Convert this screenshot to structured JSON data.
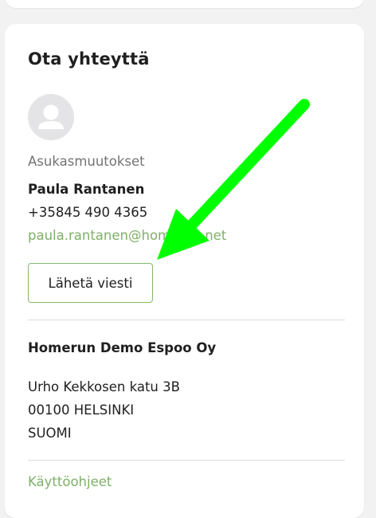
{
  "contact": {
    "title": "Ota yhteyttä",
    "role": "Asukasmuutokset",
    "name": "Paula Rantanen",
    "phone": "+35845 490 4365",
    "email": "paula.rantanen@homerun.net",
    "send_button_label": "Lähetä viesti"
  },
  "company": {
    "name": "Homerun Demo Espoo Oy",
    "address_line1": "Urho Kekkosen katu 3B",
    "address_line2": "00100 HELSINKI",
    "address_line3": "SUOMI"
  },
  "next_section": {
    "label": "Käyttöohjeet"
  },
  "colors": {
    "accent": "#7fb069",
    "annotation_arrow": "#00ff00"
  },
  "icons": {
    "avatar": "user-avatar-icon",
    "annotation": "arrow-annotation-icon"
  }
}
